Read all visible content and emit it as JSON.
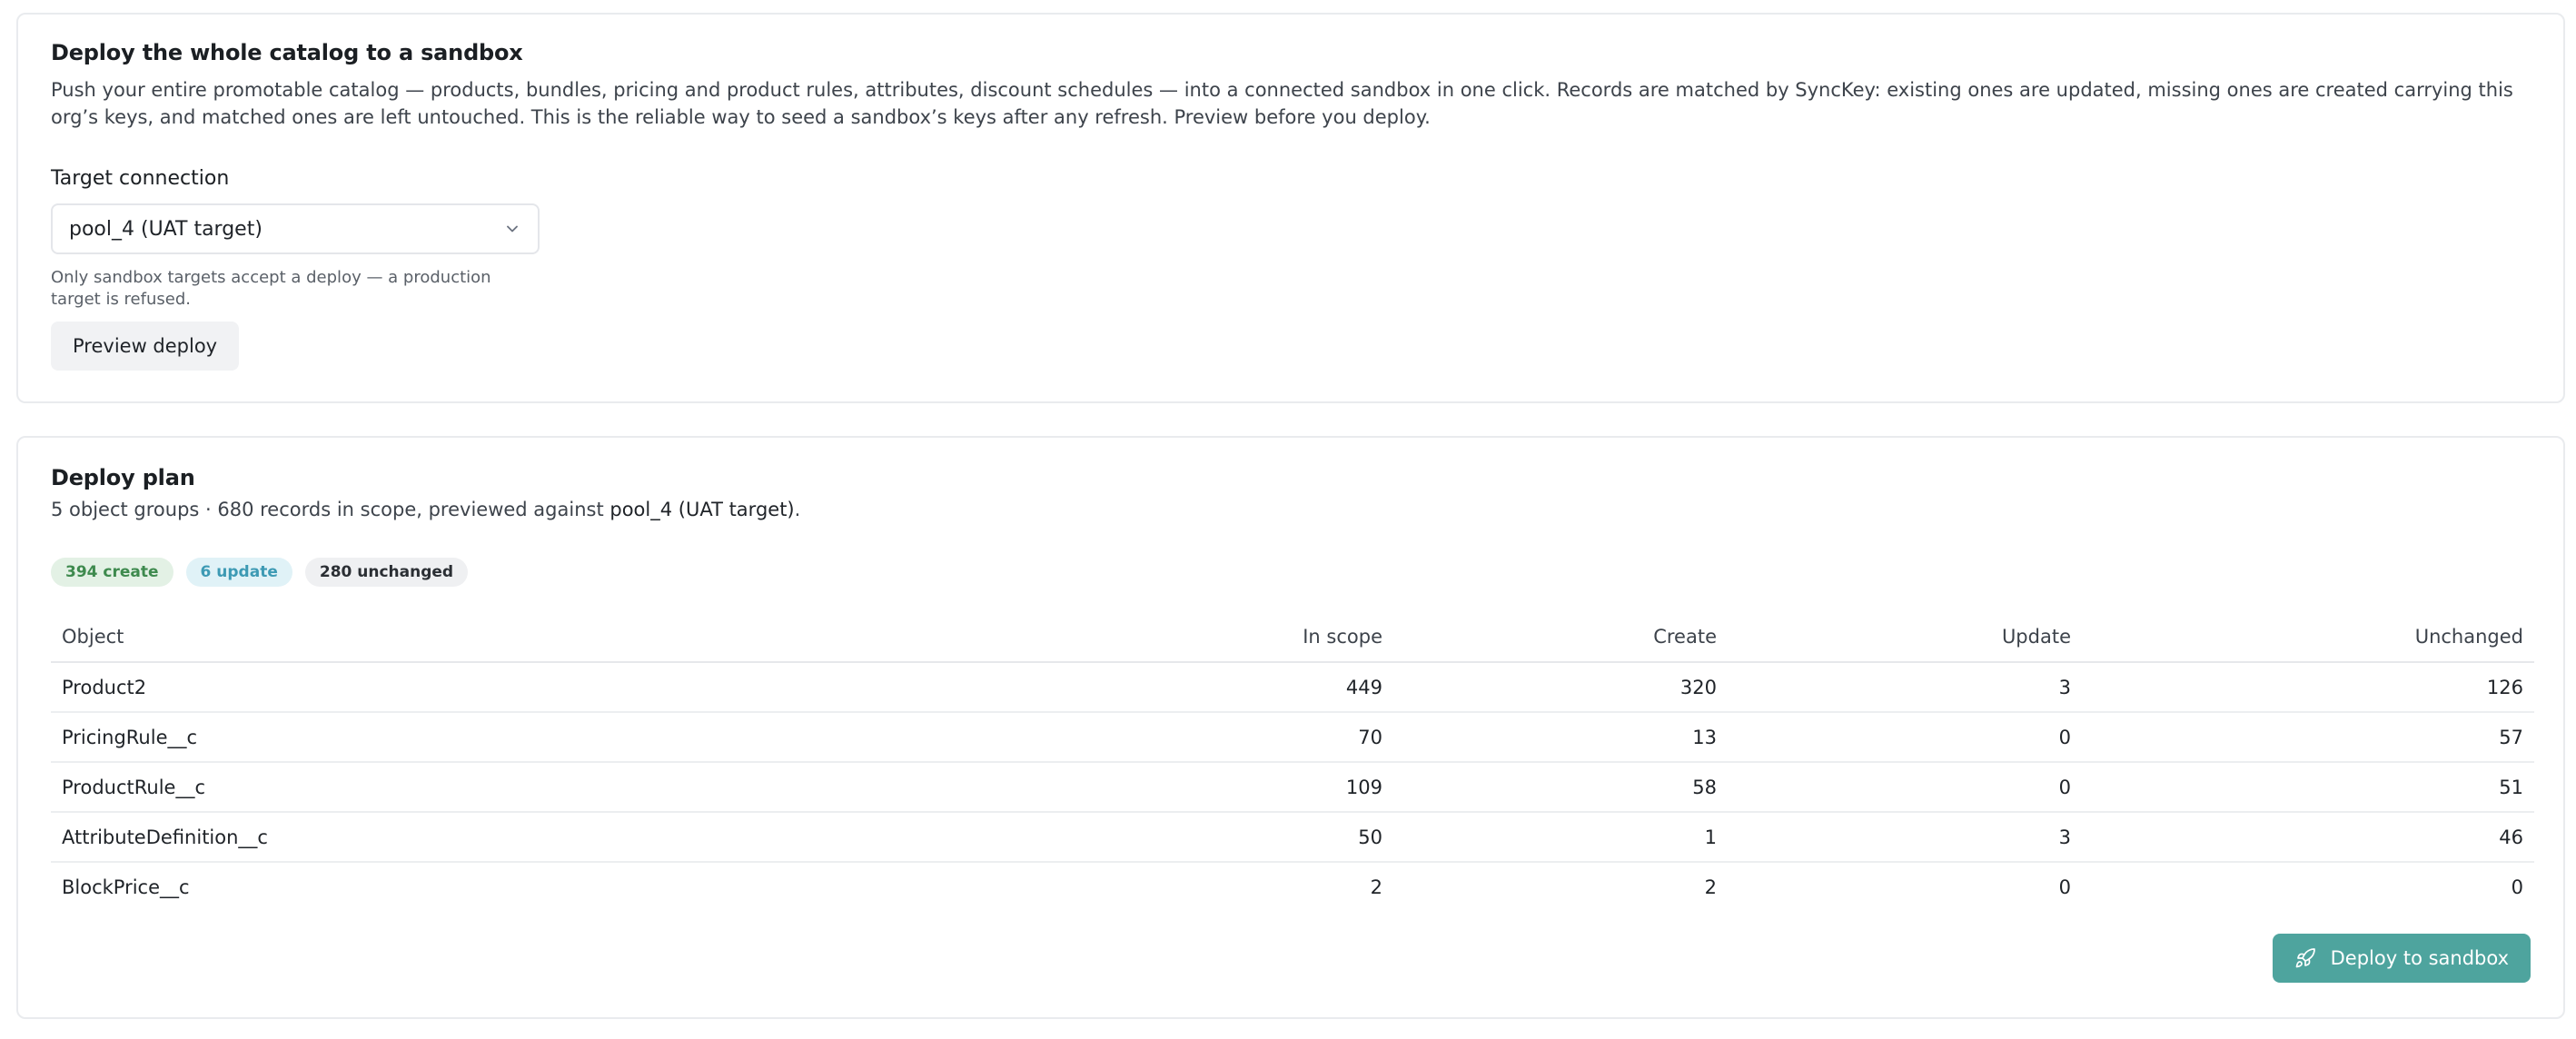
{
  "deploy_catalog": {
    "title": "Deploy the whole catalog to a sandbox",
    "description": "Push your entire promotable catalog — products, bundles, pricing and product rules, attributes, discount schedules — into a connected sandbox in one click. Records are matched by SyncKey: existing ones are updated, missing ones are created carrying this org’s keys, and matched ones are left untouched. This is the reliable way to seed a sandbox’s keys after any refresh. Preview before you deploy.",
    "target_label": "Target connection",
    "target_value": "pool_4 (UAT target)",
    "target_hint": "Only sandbox targets accept a deploy — a production target is refused.",
    "preview_button": "Preview deploy",
    "icons": {
      "select": "chevron-down-icon"
    }
  },
  "deploy_plan": {
    "title": "Deploy plan",
    "summary_prefix": "5 object groups · 680 records in scope, previewed against",
    "summary_target": "pool_4 (UAT target)",
    "summary_suffix": ".",
    "badges": {
      "create": "394 create",
      "update": "6 update",
      "unchanged": "280 unchanged"
    },
    "badge_colors": {
      "create_bg": "#e3f1e5",
      "create_fg": "#3e8a4e",
      "update_bg": "#e0f2f7",
      "update_fg": "#3d9ab4",
      "unchanged_bg": "#eff0f2",
      "unchanged_fg": "#2b2f34"
    },
    "columns": {
      "object": "Object",
      "in_scope": "In scope",
      "create": "Create",
      "update": "Update",
      "unchanged": "Unchanged"
    },
    "rows": [
      {
        "object": "Product2",
        "in_scope": "449",
        "create": "320",
        "update": "3",
        "unchanged": "126"
      },
      {
        "object": "PricingRule__c",
        "in_scope": "70",
        "create": "13",
        "update": "0",
        "unchanged": "57"
      },
      {
        "object": "ProductRule__c",
        "in_scope": "109",
        "create": "58",
        "update": "0",
        "unchanged": "51"
      },
      {
        "object": "AttributeDefinition__c",
        "in_scope": "50",
        "create": "1",
        "update": "3",
        "unchanged": "46"
      },
      {
        "object": "BlockPrice__c",
        "in_scope": "2",
        "create": "2",
        "update": "0",
        "unchanged": "0"
      }
    ],
    "deploy_button": "Deploy to sandbox",
    "accent_color": "#4ea49e",
    "icons": {
      "deploy": "rocket-icon"
    }
  }
}
